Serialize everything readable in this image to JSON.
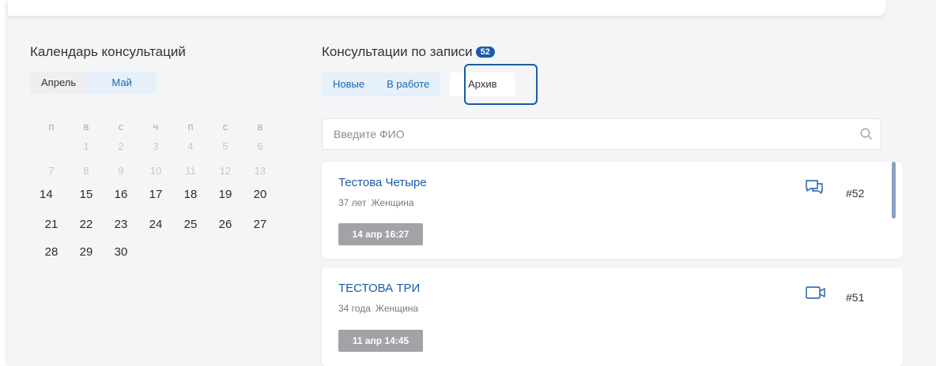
{
  "calendar": {
    "title": "Календарь консультаций",
    "months": [
      "Апрель",
      "Май"
    ],
    "weekdays": [
      "п",
      "в",
      "с",
      "ч",
      "п",
      "с",
      "в"
    ],
    "weeks": [
      [
        "",
        "1",
        "2",
        "3",
        "4",
        "5",
        "6"
      ],
      [
        "7",
        "8",
        "9",
        "10",
        "11",
        "12",
        "13"
      ],
      [
        "14",
        "15",
        "16",
        "17",
        "18",
        "19",
        "20"
      ],
      [
        "21",
        "22",
        "23",
        "24",
        "25",
        "26",
        "27"
      ],
      [
        "28",
        "29",
        "30",
        "",
        "",
        "",
        ""
      ]
    ]
  },
  "consultations": {
    "title": "Консультации по записи",
    "count": "52",
    "tabs": [
      "Новые",
      "В работе",
      "Архив"
    ],
    "search_placeholder": "Введите ФИО",
    "cards": [
      {
        "name": "Тестова Четыре",
        "age": "37 лет",
        "gender": "Женщина",
        "date": "14 апр 16:27",
        "number": "#52",
        "icon": "chat-icon"
      },
      {
        "name": "ТЕСТОВА ТРИ",
        "age": "34 года",
        "gender": "Женщина",
        "date": "11 апр 14:45",
        "number": "#51",
        "icon": "video-icon"
      }
    ]
  },
  "colors": {
    "accent": "#1a5aa8",
    "tab_bg": "#e6f0fa",
    "date_bg": "#a1a3a6"
  }
}
